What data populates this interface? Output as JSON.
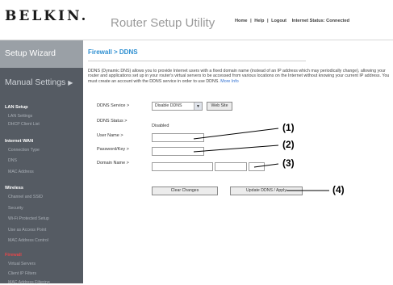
{
  "header": {
    "logo": "BELKIN.",
    "title": "Router Setup Utility",
    "links": [
      "Home",
      "|",
      "Help",
      "|",
      "Logout"
    ],
    "status": "Internet Status: Connected"
  },
  "sidebar": {
    "setup_wizard": "Setup Wizard",
    "manual_settings": "Manual Settings",
    "manual_settings_arrow": "▶",
    "sections": [
      {
        "title": "LAN Setup",
        "items": [
          "LAN Settings",
          "DHCP Client List"
        ]
      },
      {
        "title": "Internet WAN",
        "items": [
          "Connection Type",
          "DNS",
          "MAC Address"
        ]
      },
      {
        "title": "Wireless",
        "items": [
          "Channel and SSID",
          "Security",
          "Wi-Fi Protected Setup",
          "Use as Access Point",
          "MAC Address Control"
        ]
      },
      {
        "title": "Firewall",
        "items": [
          "Virtual Servers",
          "Client IP Filters",
          "MAC Address Filtering"
        ]
      }
    ]
  },
  "main": {
    "breadcrumb": "Firewall > DDNS",
    "description": "DDNS (Dynamic DNS) allows you to provide Internet users with a fixed domain name (instead of an IP address which may periodically change), allowing your router and applications set up in your router's virtual servers to be accessed from various locations on the Internet without knowing your current IP address. You must create an account with the DDNS service in order to use DDNS.",
    "more_info": "More Info",
    "ddns_service_label": "DDNS Service >",
    "ddns_service_value": "Disable DDNS",
    "web_site_button": "Web Site",
    "ddns_status_label": "DDNS Status >",
    "ddns_status_value": "Disabled",
    "username_label": "User Name >",
    "username_value": "",
    "password_label": "Password/Key >",
    "password_value": "",
    "domain_label": "Domain Name >",
    "domain_values": [
      "",
      "",
      ""
    ],
    "clear_button": "Clear Changes",
    "apply_button": "Update DDNS / Apply"
  },
  "callouts": [
    "(1)",
    "(2)",
    "(3)",
    "(4)"
  ]
}
